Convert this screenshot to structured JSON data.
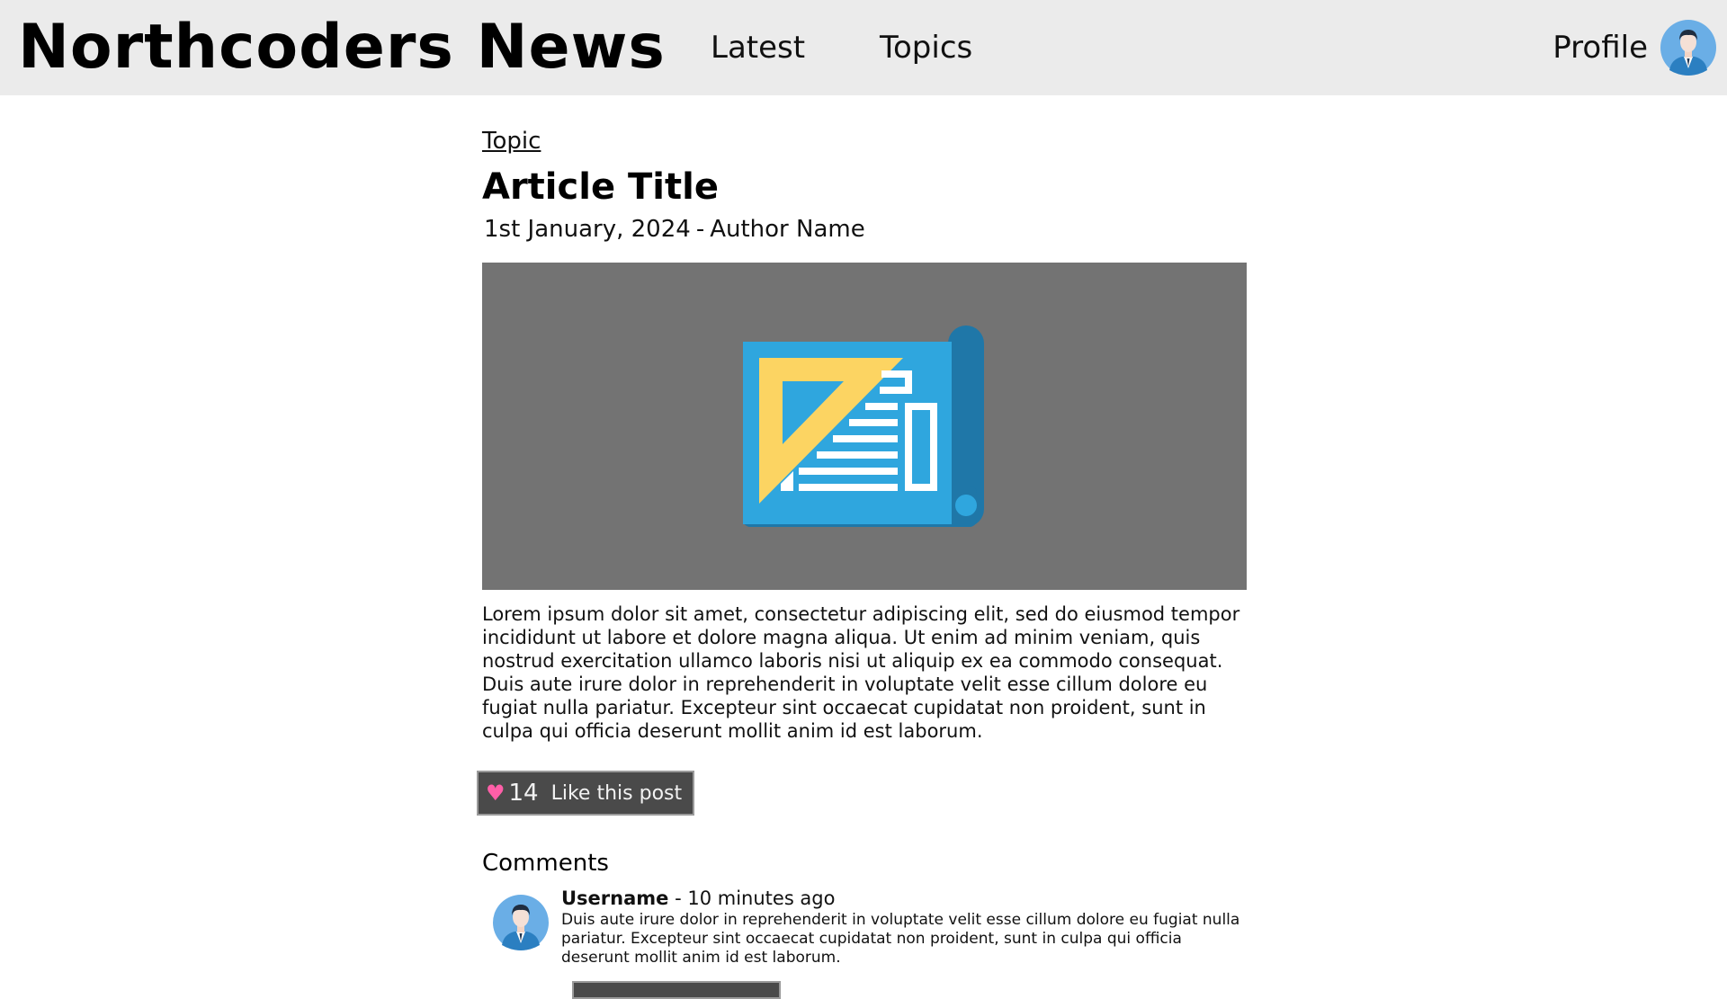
{
  "header": {
    "brand": "Northcoders News",
    "nav": [
      {
        "label": "Latest"
      },
      {
        "label": "Topics"
      }
    ],
    "profile_label": "Profile",
    "profile_avatar_icon": "user-avatar-icon"
  },
  "article": {
    "topic": "Topic",
    "title": "Article Title",
    "date": "1st January, 2024",
    "separator": "-",
    "author": "Author Name",
    "hero_icon": "newspaper-icon",
    "body": "Lorem ipsum dolor sit amet, consectetur adipiscing elit, sed do eiusmod tempor incididunt ut labore et dolore magna aliqua. Ut enim ad minim veniam, quis nostrud exercitation ullamco laboris nisi ut aliquip ex ea commodo consequat. Duis aute irure dolor in reprehenderit in voluptate velit esse cillum dolore eu fugiat nulla pariatur. Excepteur sint occaecat cupidatat non proident, sunt in culpa qui officia deserunt mollit anim id est laborum.",
    "like": {
      "icon": "heart-icon",
      "count": "14",
      "label": "Like this post"
    }
  },
  "comments": {
    "heading": "Comments",
    "items": [
      {
        "username": "Username",
        "separator": "-",
        "time": "10 minutes ago",
        "text": "Duis aute irure dolor in reprehenderit in voluptate velit esse cillum dolore eu fugiat nulla pariatur. Excepteur sint occaecat cupidatat non proident, sunt in culpa qui officia deserunt mollit anim id est laborum."
      }
    ]
  },
  "colors": {
    "header_bg": "#ebebeb",
    "hero_bg": "#737373",
    "button_bg": "#4a4a4a",
    "heart": "#ff5fa8",
    "avatar_bg": "#6aaee6"
  }
}
